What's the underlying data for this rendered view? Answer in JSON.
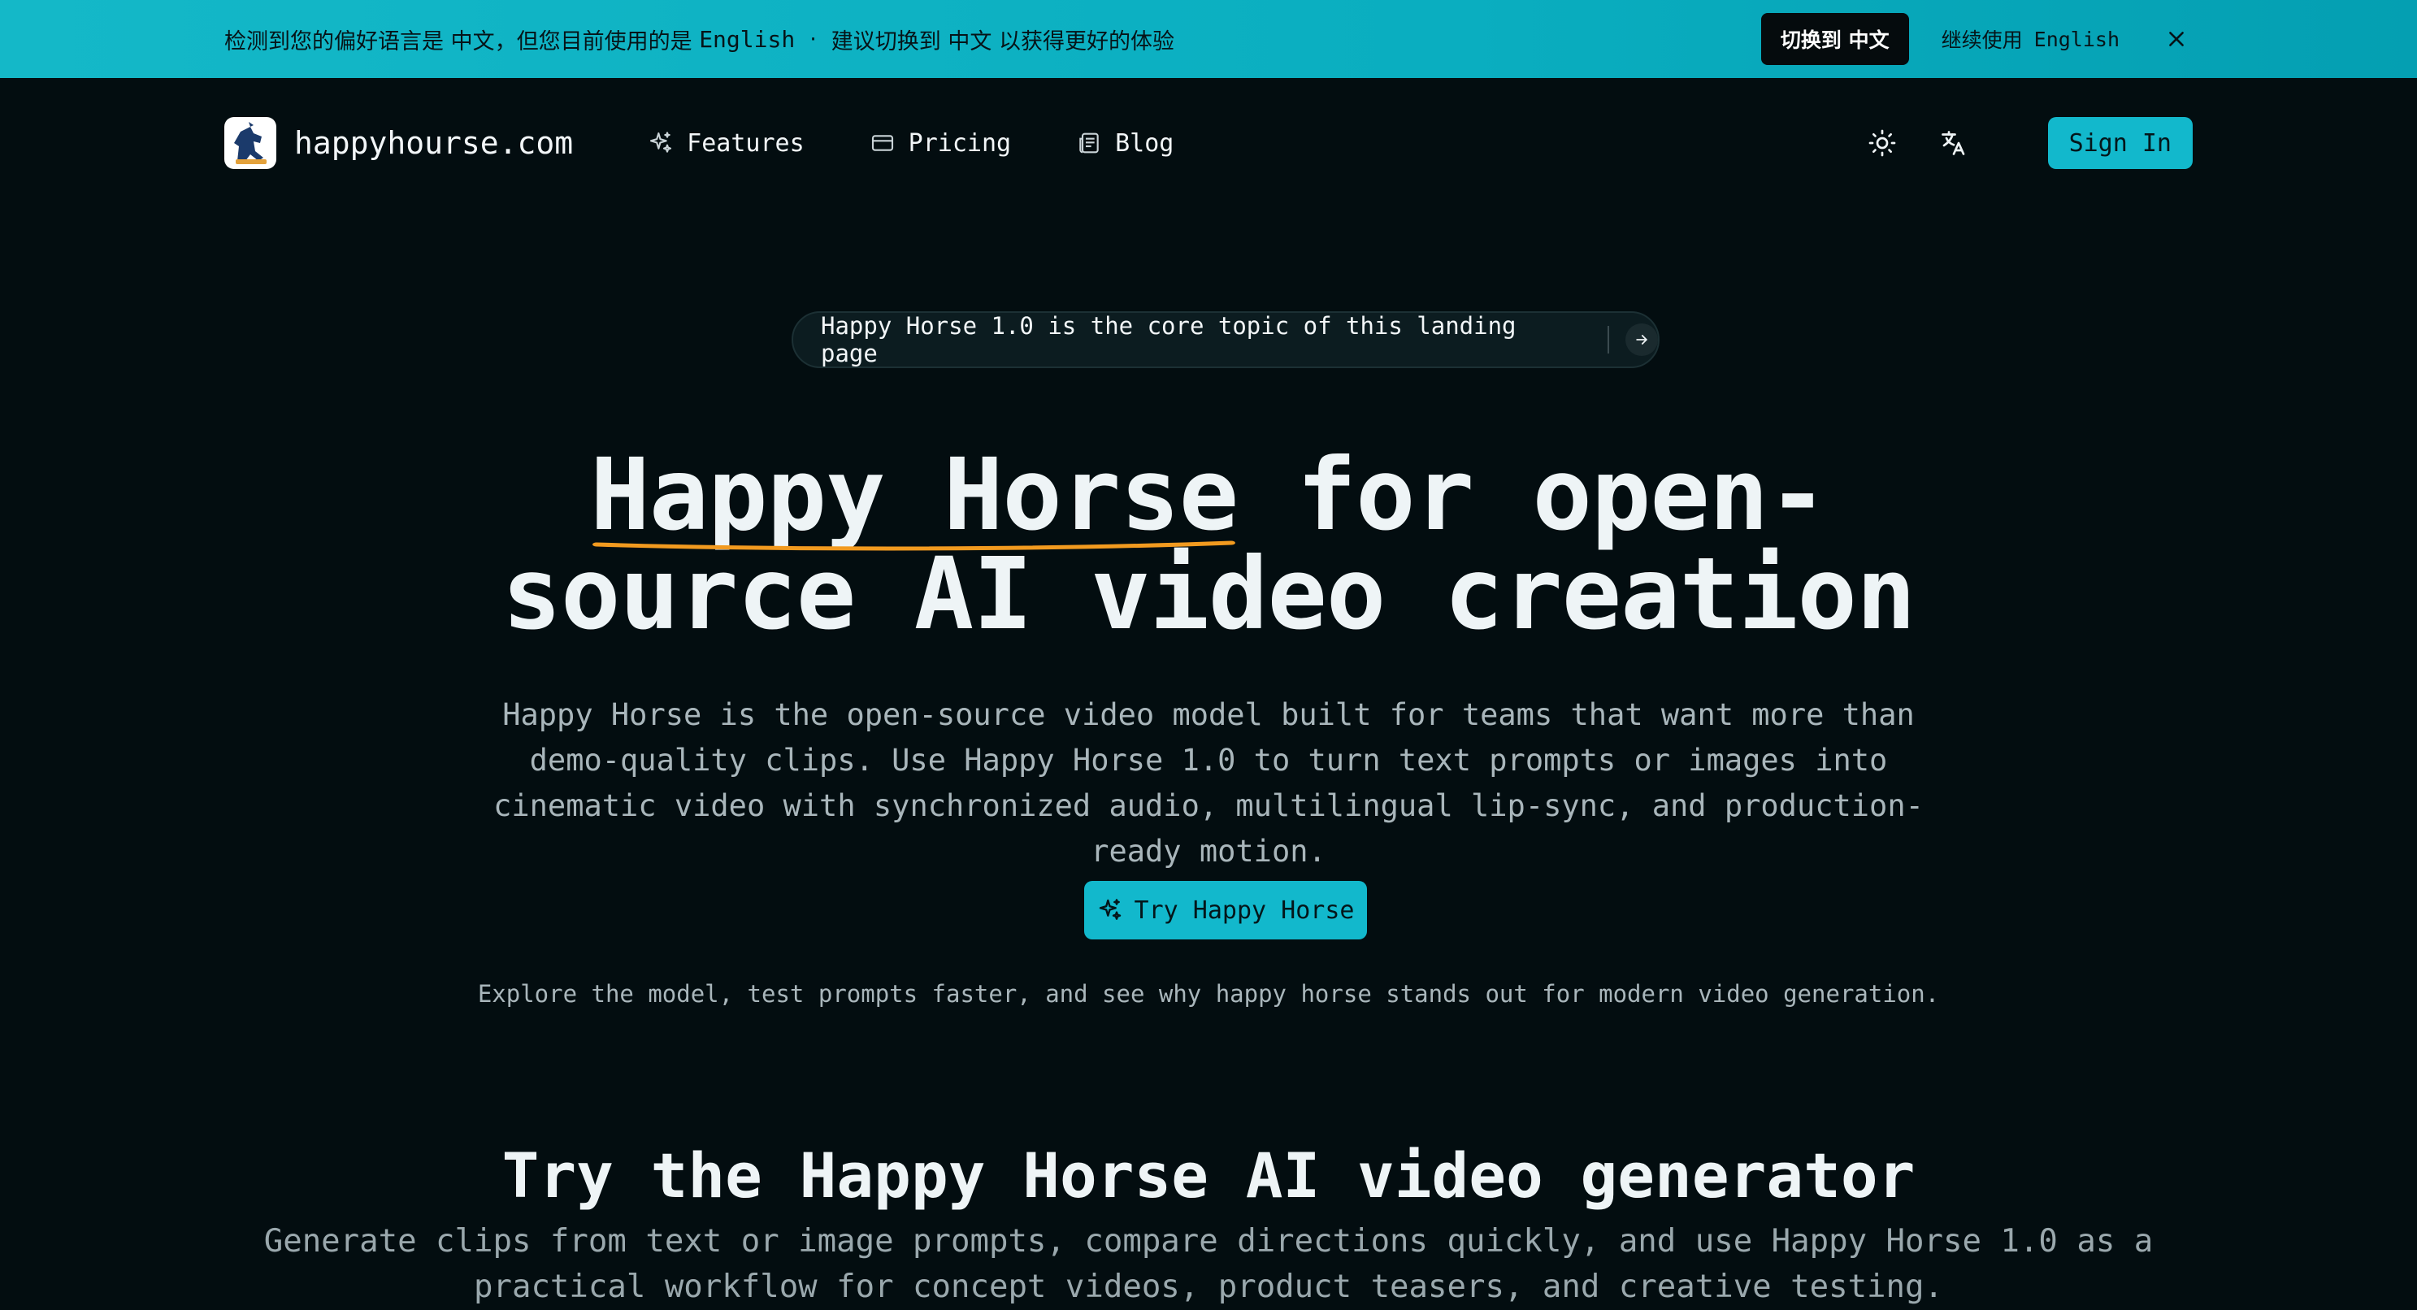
{
  "banner": {
    "prefix": "检测到您的偏好语言是 ",
    "preferred_lang": "中文",
    "middle": "，但您目前使用的是 ",
    "current_lang": "English",
    "separator": "·",
    "suggest": "建议切换到 ",
    "suggest_lang": "中文",
    "suffix": " 以获得更好的体验",
    "switch_label": "切换到 中文",
    "keep_prefix": "继续使用",
    "keep_lang": "English"
  },
  "nav": {
    "brand": "happyhourse.com",
    "links": [
      {
        "label": "Features",
        "icon": "sparkles-icon"
      },
      {
        "label": "Pricing",
        "icon": "credit-card-icon"
      },
      {
        "label": "Blog",
        "icon": "newspaper-icon"
      }
    ],
    "sign_in": "Sign In"
  },
  "pill": {
    "text": "Happy Horse 1.0 is the core topic of this landing page"
  },
  "hero": {
    "title_highlight": "Happy Horse",
    "title_rest_line1": " for open-",
    "title_line2": "source AI video creation",
    "subtitle": "Happy Horse is the open-source video model built for teams that want more than demo-quality clips. Use Happy Horse 1.0 to turn text prompts or images into cinematic video with synchronized audio, multilingual lip-sync, and production-ready motion.",
    "cta": "Try Happy Horse",
    "explore": "Explore the model, test prompts faster, and see why happy horse stands out for modern video generation."
  },
  "section": {
    "title": "Try the Happy Horse AI video generator",
    "subtitle": "Generate clips from text or image prompts, compare directions quickly, and use Happy Horse 1.0 as a practical workflow for concept videos, product teasers, and creative testing."
  },
  "colors": {
    "accent": "#12b8cc",
    "underline": "#f29a1f",
    "background": "#030d10"
  }
}
